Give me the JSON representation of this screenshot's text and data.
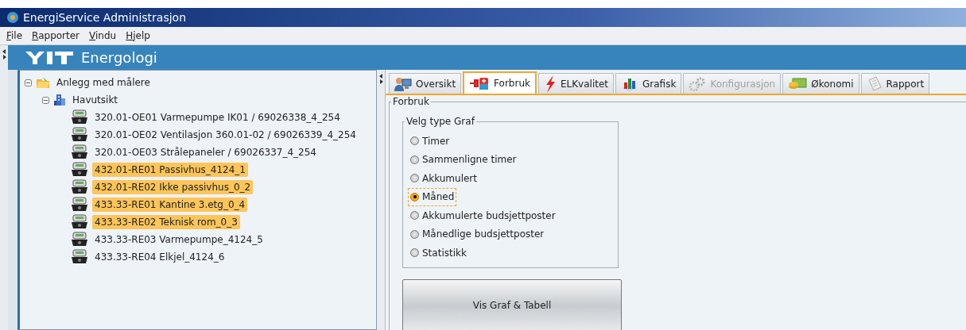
{
  "window": {
    "title": "EnergiService Administrasjon"
  },
  "menu": [
    "File",
    "Rapporter",
    "Vindu",
    "Hjelp"
  ],
  "header": {
    "title": "Energologi"
  },
  "tree": [
    {
      "label": "Anlegg med målere",
      "kind": "folder",
      "expanded": true,
      "selected": false,
      "children": [
        {
          "label": "Havutsikt",
          "kind": "building",
          "expanded": true,
          "selected": false,
          "children": [
            {
              "label": "320.01-OE01 Varmepumpe IK01 / 69026338_4_254",
              "kind": "meter",
              "selected": false
            },
            {
              "label": "320.01-OE02 Ventilasjon 360.01-02 / 69026339_4_254",
              "kind": "meter",
              "selected": false
            },
            {
              "label": "320.01-OE03 Strålepaneler / 69026337_4_254",
              "kind": "meter",
              "selected": false
            },
            {
              "label": "432.01-RE01 Passivhus_4124_1",
              "kind": "meter",
              "selected": true
            },
            {
              "label": "432.01-RE02 Ikke passivhus_0_2",
              "kind": "meter",
              "selected": true
            },
            {
              "label": "433.33-RE01 Kantine 3.etg_0_4",
              "kind": "meter",
              "selected": true
            },
            {
              "label": "433.33-RE02 Teknisk rom_0_3",
              "kind": "meter",
              "selected": true
            },
            {
              "label": "433.33-RE03 Varmepumpe_4124_5",
              "kind": "meter",
              "selected": false
            },
            {
              "label": "433.33-RE04 Elkjel_4124_6",
              "kind": "meter",
              "selected": false
            }
          ]
        }
      ]
    }
  ],
  "tabs": [
    {
      "label": "Oversikt",
      "kind": "overview",
      "selected": false,
      "disabled": false
    },
    {
      "label": "Forbruk",
      "kind": "consumption",
      "selected": true,
      "disabled": false
    },
    {
      "label": "ELKvalitet",
      "kind": "quality",
      "selected": false,
      "disabled": false
    },
    {
      "label": "Grafisk",
      "kind": "graph",
      "selected": false,
      "disabled": false
    },
    {
      "label": "Konfigurasjon",
      "kind": "config",
      "selected": false,
      "disabled": true
    },
    {
      "label": "Økonomi",
      "kind": "money",
      "selected": false,
      "disabled": false
    },
    {
      "label": "Rapport",
      "kind": "report",
      "selected": false,
      "disabled": false
    }
  ],
  "panel": {
    "title": "Forbruk",
    "group_title": "Velg type Graf",
    "options": [
      {
        "label": "Timer",
        "selected": false
      },
      {
        "label": "Sammenligne timer",
        "selected": false
      },
      {
        "label": "Akkumulert",
        "selected": false
      },
      {
        "label": "Måned",
        "selected": true
      },
      {
        "label": "Akkumulerte budsjettposter",
        "selected": false
      },
      {
        "label": "Månedlige budsjettposter",
        "selected": false
      },
      {
        "label": "Statistikk",
        "selected": false
      }
    ],
    "button": "Vis Graf & Tabell"
  }
}
